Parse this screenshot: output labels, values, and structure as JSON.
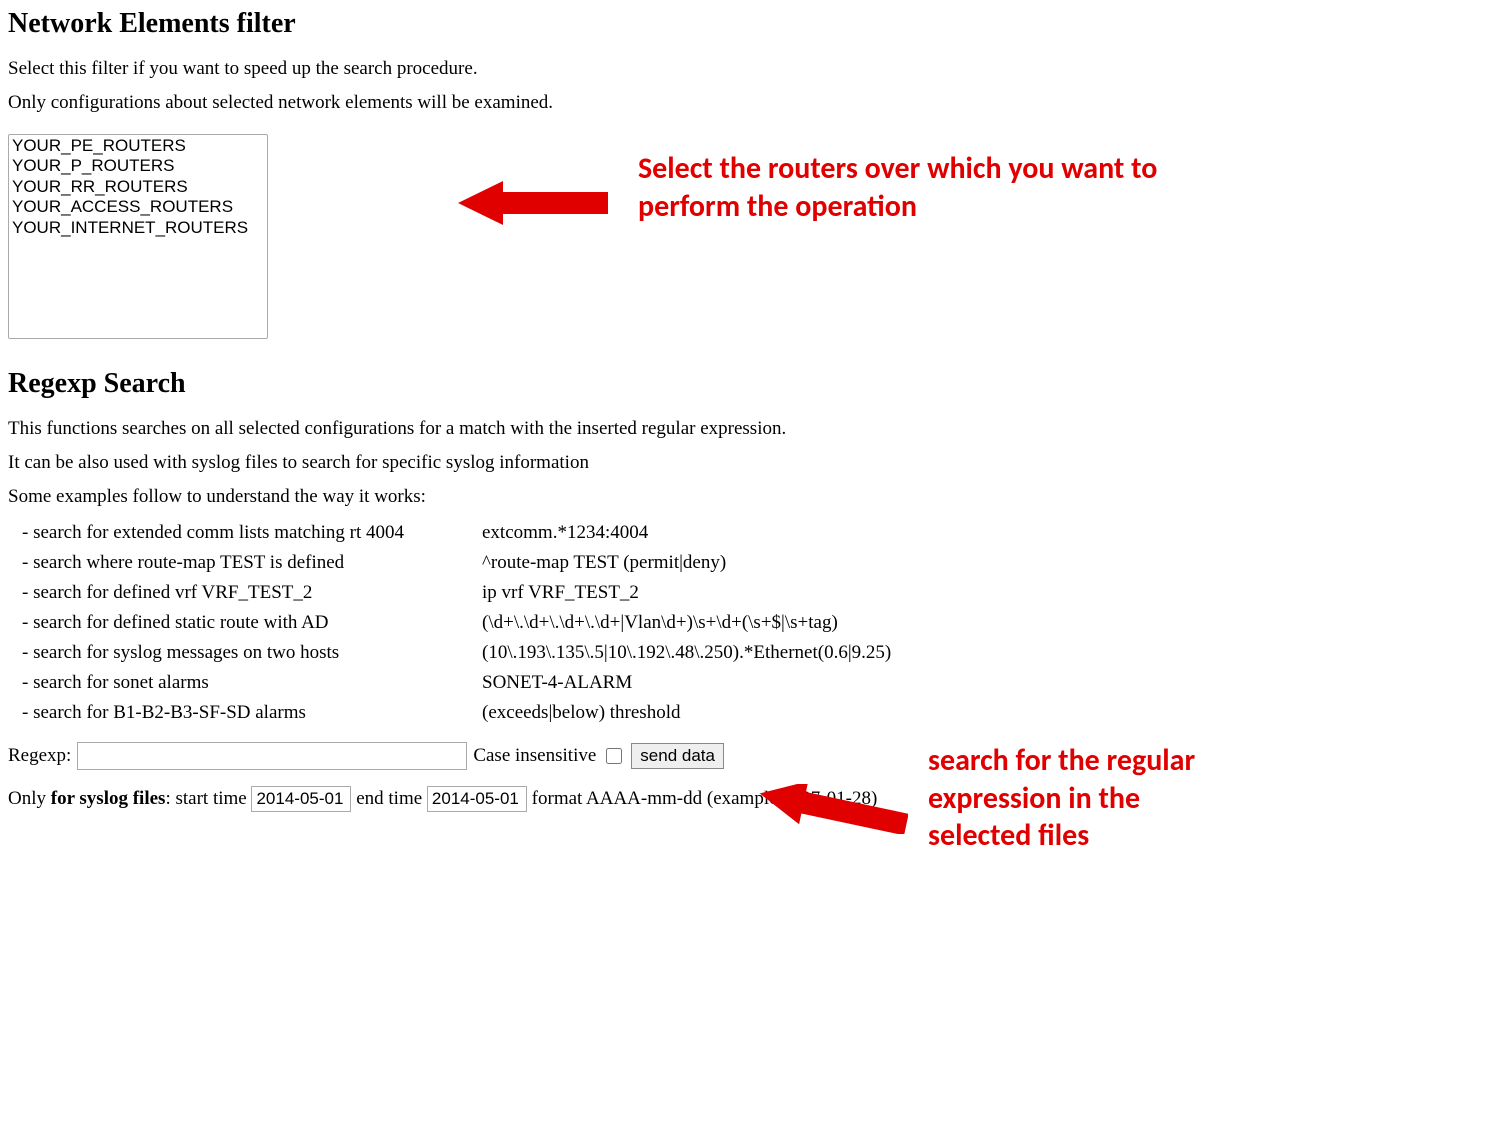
{
  "filter": {
    "heading": "Network Elements filter",
    "desc1": "Select this filter if you want to speed up the search procedure.",
    "desc2": "Only configurations about selected network elements will be examined.",
    "options": [
      "YOUR_PE_ROUTERS",
      "YOUR_P_ROUTERS",
      "YOUR_RR_ROUTERS",
      "YOUR_ACCESS_ROUTERS",
      "YOUR_INTERNET_ROUTERS"
    ]
  },
  "annotations": {
    "top": "Select the routers over which you want to perform the operation",
    "bottom": "search for the regular expression in the selected files"
  },
  "regexp": {
    "heading": "Regexp Search",
    "desc1": "This functions searches on all selected configurations for a match with the inserted regular expression.",
    "desc2": "It can be also used with syslog files to search for specific syslog information",
    "desc3": "Some examples follow to understand the way it works:",
    "examples": [
      {
        "desc": "- search for extended comm lists matching rt 4004",
        "pat": "extcomm.*1234:4004"
      },
      {
        "desc": "- search where route-map TEST is defined",
        "pat": "^route-map TEST (permit|deny)"
      },
      {
        "desc": "- search for defined vrf VRF_TEST_2",
        "pat": "ip vrf VRF_TEST_2"
      },
      {
        "desc": "- search for defined static route with AD",
        "pat": "(\\d+\\.\\d+\\.\\d+\\.\\d+|Vlan\\d+)\\s+\\d+(\\s+$|\\s+tag)"
      },
      {
        "desc": "- search for syslog messages on two hosts",
        "pat": "(10\\.193\\.135\\.5|10\\.192\\.48\\.250).*Ethernet(0.6|9.25)"
      },
      {
        "desc": "- search for sonet alarms",
        "pat": "SONET-4-ALARM"
      },
      {
        "desc": "- search for B1-B2-B3-SF-SD alarms",
        "pat": "(exceeds|below) threshold"
      }
    ],
    "label": "Regexp:",
    "case_label": "Case insensitive",
    "send_label": "send data",
    "input_value": ""
  },
  "syslog": {
    "prefix": "Only ",
    "bold": "for syslog files",
    "start_label": ": start time ",
    "start_value": "2014-05-01",
    "end_label": " end time ",
    "end_value": "2014-05-01",
    "format_label": " format AAAA-mm-dd (example 2007-01-28)"
  }
}
